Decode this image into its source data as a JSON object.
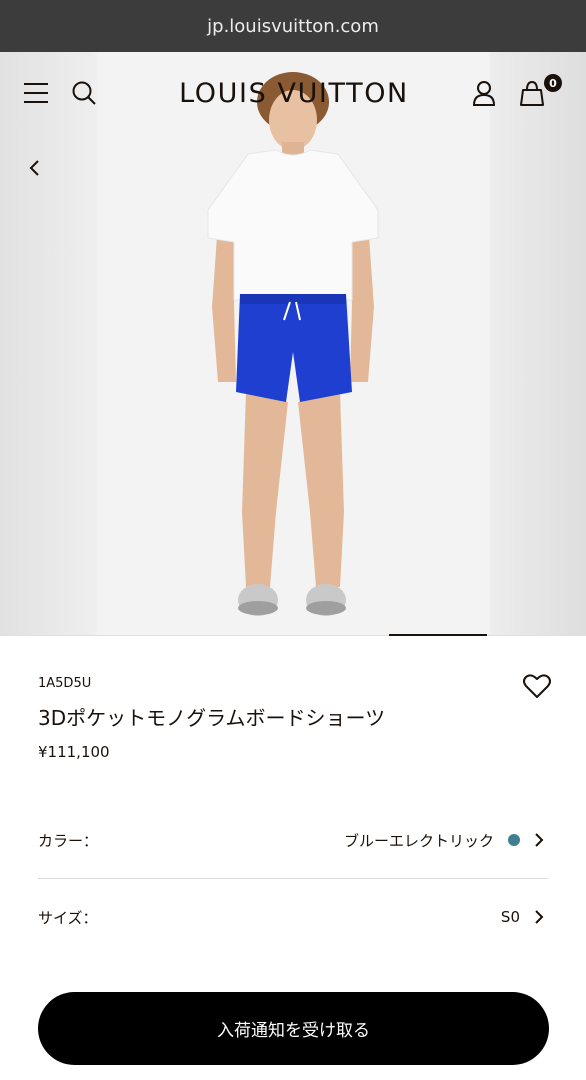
{
  "browser": {
    "url": "jp.louisvuitton.com"
  },
  "header": {
    "logo": "LOUIS VUITTON",
    "cart_count": "0"
  },
  "product": {
    "sku": "1A5D5U",
    "name": "3Dポケットモノグラムボードショーツ",
    "price": "¥111,100",
    "shorts_color": "#1f3fd0"
  },
  "options": {
    "color_label": "カラー：",
    "color_value": "ブルーエレクトリック",
    "color_swatch": "#3e7f93",
    "size_label": "サイズ：",
    "size_value": "S0"
  },
  "cta": {
    "label": "入荷通知を受け取る"
  },
  "carousel": {
    "active_index": 1,
    "slide_count": 6
  }
}
